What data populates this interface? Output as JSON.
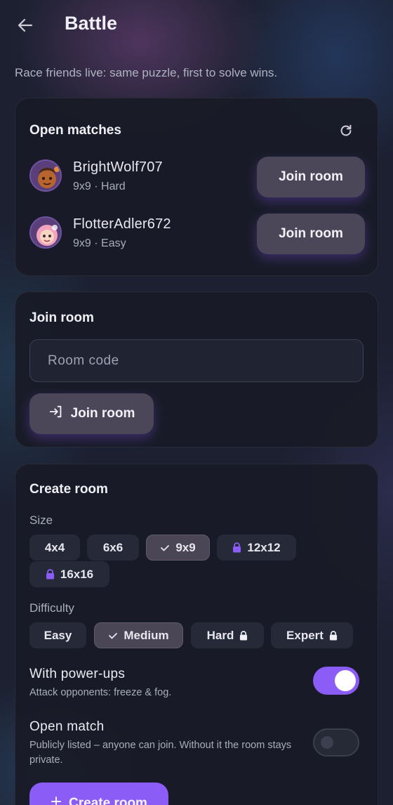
{
  "header": {
    "title": "Battle",
    "subtitle": "Race friends live: same puzzle, first to solve wins."
  },
  "open_matches": {
    "title": "Open matches",
    "matches": [
      {
        "name": "BrightWolf707",
        "meta": "9x9 · Hard",
        "button": "Join room"
      },
      {
        "name": "FlotterAdler672",
        "meta": "9x9 · Easy",
        "button": "Join room"
      }
    ]
  },
  "join_room": {
    "title": "Join room",
    "placeholder": "Room code",
    "value": "",
    "button": "Join room"
  },
  "create_room": {
    "title": "Create room",
    "size_label": "Size",
    "sizes": [
      {
        "label": "4x4",
        "selected": false,
        "locked": false
      },
      {
        "label": "6x6",
        "selected": false,
        "locked": false
      },
      {
        "label": "9x9",
        "selected": true,
        "locked": false
      },
      {
        "label": "12x12",
        "selected": false,
        "locked": true
      },
      {
        "label": "16x16",
        "selected": false,
        "locked": true
      }
    ],
    "difficulty_label": "Difficulty",
    "difficulties": [
      {
        "label": "Easy",
        "selected": false,
        "locked": false
      },
      {
        "label": "Medium",
        "selected": true,
        "locked": false
      },
      {
        "label": "Hard",
        "selected": false,
        "locked": true
      },
      {
        "label": "Expert",
        "selected": false,
        "locked": true
      }
    ],
    "powerups": {
      "title": "With power-ups",
      "desc": "Attack opponents: freeze & fog.",
      "enabled": true
    },
    "open_match": {
      "title": "Open match",
      "desc": "Publicly listed – anyone can join. Without it the room stays private.",
      "enabled": false
    },
    "button": "Create room"
  },
  "colors": {
    "accent": "#8b5cf6",
    "lock": "#8b5cf6"
  },
  "icons": [
    "back-arrow-icon",
    "refresh-icon",
    "login-icon",
    "check-icon",
    "lock-icon",
    "plus-icon"
  ]
}
